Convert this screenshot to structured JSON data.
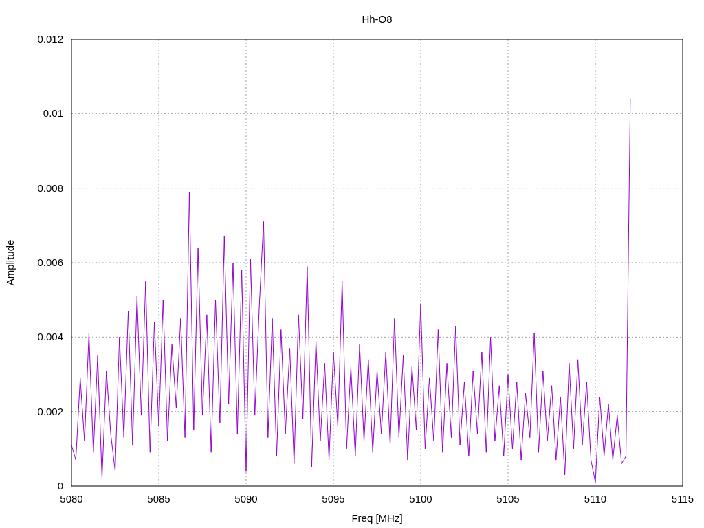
{
  "chart_data": {
    "type": "line",
    "grid": true,
    "title": "Hh-O8",
    "xlabel": "Freq [MHz]",
    "ylabel": "Amplitude",
    "xlim": [
      5080,
      5115
    ],
    "ylim": [
      0,
      0.012
    ],
    "xticks": [
      5080,
      5085,
      5090,
      5095,
      5100,
      5105,
      5110,
      5115
    ],
    "yticks": [
      0,
      0.002,
      0.004,
      0.006,
      0.008,
      0.01,
      0.012
    ],
    "x": [
      5080,
      5080.25,
      5080.5,
      5080.75,
      5081,
      5081.25,
      5081.5,
      5081.75,
      5082,
      5082.25,
      5082.5,
      5082.75,
      5083,
      5083.25,
      5083.5,
      5083.75,
      5084,
      5084.25,
      5084.5,
      5084.75,
      5085,
      5085.25,
      5085.5,
      5085.75,
      5086,
      5086.25,
      5086.5,
      5086.75,
      5087,
      5087.25,
      5087.5,
      5087.75,
      5088,
      5088.25,
      5088.5,
      5088.75,
      5089,
      5089.25,
      5089.5,
      5089.75,
      5090,
      5090.25,
      5090.5,
      5090.75,
      5091,
      5091.25,
      5091.5,
      5091.75,
      5092,
      5092.25,
      5092.5,
      5092.75,
      5093,
      5093.25,
      5093.5,
      5093.75,
      5094,
      5094.25,
      5094.5,
      5094.75,
      5095,
      5095.25,
      5095.5,
      5095.75,
      5096,
      5096.25,
      5096.5,
      5096.75,
      5097,
      5097.25,
      5097.5,
      5097.75,
      5098,
      5098.25,
      5098.5,
      5098.75,
      5099,
      5099.25,
      5099.5,
      5099.75,
      5100,
      5100.25,
      5100.5,
      5100.75,
      5101,
      5101.25,
      5101.5,
      5101.75,
      5102,
      5102.25,
      5102.5,
      5102.75,
      5103,
      5103.25,
      5103.5,
      5103.75,
      5104,
      5104.25,
      5104.5,
      5104.75,
      5105,
      5105.25,
      5105.5,
      5105.75,
      5106,
      5106.25,
      5106.5,
      5106.75,
      5107,
      5107.25,
      5107.5,
      5107.75,
      5108,
      5108.25,
      5108.5,
      5108.75,
      5109,
      5109.25,
      5109.5,
      5109.75,
      5110,
      5110.25,
      5110.5,
      5110.75,
      5111,
      5111.25,
      5111.5,
      5111.75,
      5112
    ],
    "series": [
      {
        "color": "#9400d3",
        "values": [
          0.0011,
          0.0007,
          0.0029,
          0.0012,
          0.0041,
          0.0009,
          0.0035,
          0.0002,
          0.0031,
          0.0014,
          0.0004,
          0.004,
          0.0013,
          0.0047,
          0.0011,
          0.0051,
          0.0019,
          0.0055,
          0.0009,
          0.0044,
          0.0016,
          0.005,
          0.0012,
          0.0038,
          0.0021,
          0.0045,
          0.0013,
          0.0079,
          0.0015,
          0.0064,
          0.0019,
          0.0046,
          0.0009,
          0.005,
          0.0017,
          0.0067,
          0.0022,
          0.006,
          0.0014,
          0.0058,
          0.0004,
          0.0061,
          0.0019,
          0.0048,
          0.0071,
          0.0013,
          0.0045,
          0.0008,
          0.0042,
          0.0014,
          0.0037,
          0.0006,
          0.0046,
          0.0018,
          0.0059,
          0.0005,
          0.0039,
          0.0012,
          0.0033,
          0.0007,
          0.0036,
          0.0016,
          0.0055,
          0.001,
          0.0032,
          0.0008,
          0.0038,
          0.0012,
          0.0034,
          0.0009,
          0.0031,
          0.0014,
          0.0036,
          0.0011,
          0.0045,
          0.0013,
          0.0035,
          0.0007,
          0.0032,
          0.0015,
          0.0049,
          0.001,
          0.0029,
          0.0012,
          0.0042,
          0.0009,
          0.0033,
          0.0013,
          0.0043,
          0.0011,
          0.0028,
          0.0008,
          0.0031,
          0.0014,
          0.0036,
          0.0009,
          0.004,
          0.0012,
          0.0027,
          0.0008,
          0.003,
          0.001,
          0.0028,
          0.0007,
          0.0025,
          0.0013,
          0.0041,
          0.0009,
          0.0031,
          0.0012,
          0.0027,
          0.0007,
          0.0024,
          0.0003,
          0.0033,
          0.001,
          0.0034,
          0.0011,
          0.0028,
          0.0007,
          0.0001,
          0.0024,
          0.0008,
          0.0022,
          0.0007,
          0.0019,
          0.0006,
          0.0008,
          0.0104
        ]
      }
    ]
  }
}
